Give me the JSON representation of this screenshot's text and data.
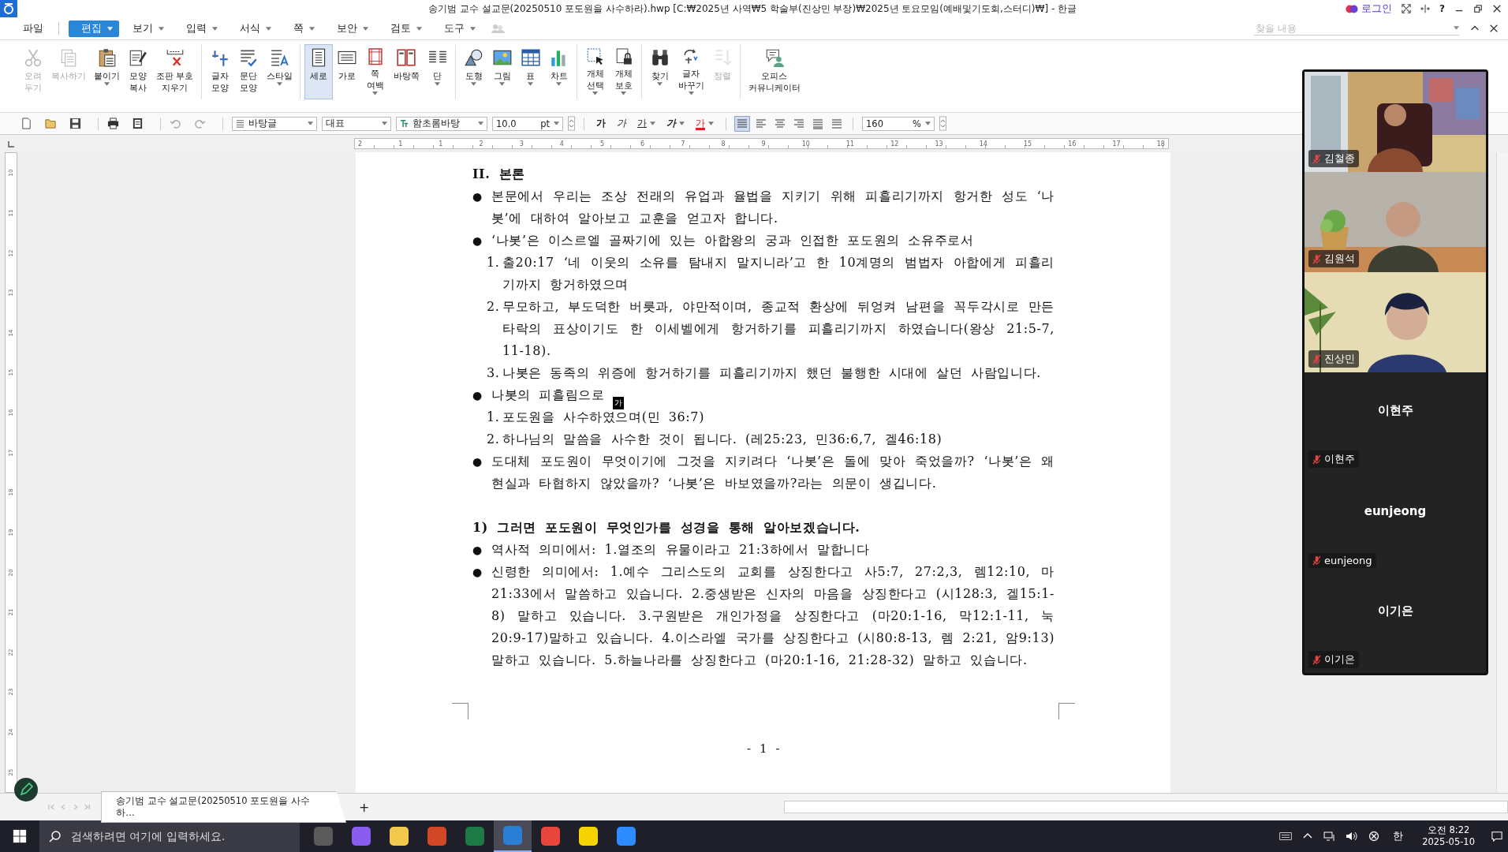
{
  "title_bar": {
    "title": "송기범 교수 설교문(20250510 포도원을 사수하라).hwp [C:₩2025년 사역₩5 학술부(진상민 부장)₩2025년 토요모임(예배및기도회,스터디)₩] - 한글",
    "login": "로그인",
    "help": "?"
  },
  "menu": [
    {
      "label": "파일",
      "dropdown": false,
      "selected": false
    },
    {
      "label": "편집",
      "dropdown": true,
      "selected": true
    },
    {
      "label": "보기",
      "dropdown": true,
      "selected": false
    },
    {
      "label": "입력",
      "dropdown": true,
      "selected": false
    },
    {
      "label": "서식",
      "dropdown": true,
      "selected": false
    },
    {
      "label": "쪽",
      "dropdown": true,
      "selected": false
    },
    {
      "label": "보안",
      "dropdown": true,
      "selected": false
    },
    {
      "label": "검토",
      "dropdown": true,
      "selected": false
    },
    {
      "label": "도구",
      "dropdown": true,
      "selected": false
    }
  ],
  "search": {
    "placeholder": "찾을 내용"
  },
  "ribbon": [
    {
      "lines": [
        "오려",
        "두기"
      ],
      "disabled": true,
      "selected": false,
      "dropdown": false,
      "separator_after": false
    },
    {
      "lines": [
        "복사하기"
      ],
      "disabled": true,
      "selected": false,
      "dropdown": false,
      "separator_after": false
    },
    {
      "lines": [
        "붙이기"
      ],
      "disabled": false,
      "selected": false,
      "dropdown": true,
      "separator_after": false
    },
    {
      "lines": [
        "모양",
        "복사"
      ],
      "disabled": false,
      "selected": false,
      "dropdown": false,
      "separator_after": false
    },
    {
      "lines": [
        "조판 부호",
        "지우기"
      ],
      "disabled": false,
      "selected": false,
      "dropdown": false,
      "separator_after": true
    },
    {
      "lines": [
        "글자",
        "모양"
      ],
      "disabled": false,
      "selected": false,
      "dropdown": false,
      "separator_after": false
    },
    {
      "lines": [
        "문단",
        "모양"
      ],
      "disabled": false,
      "selected": false,
      "dropdown": false,
      "separator_after": false
    },
    {
      "lines": [
        "스타일"
      ],
      "disabled": false,
      "selected": false,
      "dropdown": true,
      "separator_after": true
    },
    {
      "lines": [
        "세로"
      ],
      "disabled": false,
      "selected": true,
      "dropdown": false,
      "separator_after": false
    },
    {
      "lines": [
        "가로"
      ],
      "disabled": false,
      "selected": false,
      "dropdown": false,
      "separator_after": false
    },
    {
      "lines": [
        "쪽",
        "여백"
      ],
      "disabled": false,
      "selected": false,
      "dropdown": true,
      "separator_after": false
    },
    {
      "lines": [
        "바탕쪽"
      ],
      "disabled": false,
      "selected": false,
      "dropdown": false,
      "separator_after": false
    },
    {
      "lines": [
        "단"
      ],
      "disabled": false,
      "selected": false,
      "dropdown": true,
      "separator_after": true
    },
    {
      "lines": [
        "도형"
      ],
      "disabled": false,
      "selected": false,
      "dropdown": true,
      "separator_after": false
    },
    {
      "lines": [
        "그림"
      ],
      "disabled": false,
      "selected": false,
      "dropdown": true,
      "separator_after": false
    },
    {
      "lines": [
        "표"
      ],
      "disabled": false,
      "selected": false,
      "dropdown": true,
      "separator_after": false
    },
    {
      "lines": [
        "차트"
      ],
      "disabled": false,
      "selected": false,
      "dropdown": true,
      "separator_after": true
    },
    {
      "lines": [
        "개체",
        "선택"
      ],
      "disabled": false,
      "selected": false,
      "dropdown": true,
      "separator_after": false
    },
    {
      "lines": [
        "개체",
        "보호"
      ],
      "disabled": false,
      "selected": false,
      "dropdown": true,
      "separator_after": true
    },
    {
      "lines": [
        "찾기"
      ],
      "disabled": false,
      "selected": false,
      "dropdown": true,
      "separator_after": false
    },
    {
      "lines": [
        "글자",
        "바꾸기"
      ],
      "disabled": false,
      "selected": false,
      "dropdown": true,
      "separator_after": false
    },
    {
      "lines": [
        "정렬"
      ],
      "disabled": true,
      "selected": false,
      "dropdown": false,
      "separator_after": true
    },
    {
      "lines": [
        "오피스",
        "커뮤니케이터"
      ],
      "disabled": false,
      "selected": false,
      "dropdown": false,
      "separator_after": false
    }
  ],
  "format_bar": {
    "style": "바탕글",
    "language": "대표",
    "font": "함초롬바탕",
    "size": "10.0",
    "unit": "pt",
    "char_buttons": [
      {
        "kind": "bold",
        "label": "가"
      },
      {
        "kind": "italic",
        "label": "가"
      },
      {
        "kind": "underline",
        "label": "가"
      },
      {
        "kind": "strike",
        "label": "가"
      },
      {
        "kind": "color",
        "label": "가"
      }
    ],
    "align": [
      {
        "selected": true
      },
      {
        "selected": false
      },
      {
        "selected": false
      },
      {
        "selected": false
      },
      {
        "selected": false
      },
      {
        "selected": false
      }
    ],
    "zoom": "160",
    "zoom_unit": "%"
  },
  "ruler": {
    "h_marks": [
      "2",
      "1",
      "1",
      "2",
      "3",
      "4",
      "5",
      "6",
      "7",
      "8",
      "9",
      "10",
      "11",
      "12",
      "13",
      "14",
      "15",
      "16",
      "17",
      "18"
    ],
    "v_marks": [
      "10",
      "11",
      "12",
      "13",
      "14",
      "15",
      "16",
      "17",
      "18",
      "19",
      "20",
      "21",
      "22",
      "23",
      "24",
      "25"
    ]
  },
  "document": {
    "blocks": [
      {
        "kind": "heading",
        "text": "II. 본론"
      },
      {
        "kind": "bullet",
        "marker": "●",
        "text": "본문에서 우리는 조상 전래의 유업과 율법을 지키기 위해 피흘리기까지 항거한 성도 ‘나봇’에 대하여 알아보고 교훈을 얻고자 합니다."
      },
      {
        "kind": "bullet",
        "marker": "●",
        "text": "‘나봇’은 이스르엘 골짜기에 있는 아합왕의 궁과 인접한 포도원의 소유주로서",
        "children": [
          {
            "number": "1.",
            "text": "출20:17 ‘네 이웃의 소유를 탐내지 말지니라’고 한 10계명의 범법자 아합에게 피흘리기까지 항거하였으며"
          },
          {
            "number": "2.",
            "text": "무모하고, 부도덕한 버릇과, 야만적이며, 종교적 환상에 뒤엉켜 남편을 꼭두각시로 만든 타락의 표상이기도 한 이세벨에게 항거하기를 피흘리기까지 하였습니다(왕상 21:5-7, 11-18)."
          },
          {
            "number": "3.",
            "text": "나봇은 동족의 위증에 항거하기를 피흘리기까지 했던 불행한 시대에 살던 사람입니다."
          }
        ]
      },
      {
        "kind": "bullet",
        "marker": "●",
        "text": "나봇의 피흘림으로",
        "children": [
          {
            "number": "1.",
            "text": "포도원을 사수하였으며(민 36:7)"
          },
          {
            "number": "2.",
            "text": "하나님의 말씀을 사수한 것이 됩니다. (레25:23, 민36:6,7, 겔46:18)"
          }
        ]
      },
      {
        "kind": "bullet",
        "marker": "●",
        "text": "도대체 포도원이 무엇이기에 그것을 지키려다 ‘나봇’은 돌에 맞아 죽었을까? ‘나봇’은 왜 현실과 타협하지 않았을까? ‘나봇’은 바보였을까?라는 의문이 생깁니다."
      },
      {
        "kind": "subheading",
        "text": "1) 그러면 포도원이 무엇인가를 성경을 통해 알아보겠습니다."
      },
      {
        "kind": "bullet",
        "marker": "●",
        "text": "역사적 의미에서: 1.열조의 유물이라고 21:3하에서 말합니다"
      },
      {
        "kind": "bullet",
        "marker": "●",
        "text": "신령한 의미에서: 1.예수 그리스도의 교회를 상징한다고 사5:7, 27:2,3, 렘12:10, 마21:33에서 말씀하고 있습니다. 2.중생받은 신자의 마음을 상징한다고 (시128:3, 겔15:1-8) 말하고 있습니다. 3.구원받은 개인가정을 상징한다고 (마20:1-16, 막12:1-11, 눅20:9-17)말하고 있습니다. 4.이스라엘 국가를 상징한다고 (시80:8-13, 렘 2:21, 암9:13) 말하고 있습니다. 5.하늘나라를 상징한다고 (마20:1-16, 21:28-32) 말하고 있습니다."
      }
    ],
    "ime_badge": "가",
    "page_number": "- 1 -"
  },
  "meeting": {
    "participants": [
      {
        "name": "김철종",
        "video": true,
        "muted": true
      },
      {
        "name": "김원석",
        "video": true,
        "muted": true
      },
      {
        "name": "진상민",
        "video": true,
        "muted": true
      },
      {
        "name": "이현주",
        "display_name": "이현주",
        "video": false,
        "muted": true
      },
      {
        "name": "eunjeong",
        "display_name": "eunjeong",
        "video": false,
        "muted": true
      },
      {
        "name": "이기은",
        "display_name": "이기은",
        "video": false,
        "muted": true
      }
    ]
  },
  "doc_tabs": {
    "tabs": [
      {
        "label": "송기범 교수 설교문(20250510 포도원을 사수하…",
        "selected": true
      }
    ],
    "add": "+"
  },
  "taskbar": {
    "search_placeholder": "검색하려면 여기에 입력하세요.",
    "apps": [
      {
        "color": "#5a5a5a",
        "selected": false
      },
      {
        "color": "#8a5cf0",
        "selected": false
      },
      {
        "color": "#f2c94c",
        "selected": false
      },
      {
        "color": "#d24726",
        "selected": false
      },
      {
        "color": "#1d7a45",
        "selected": false
      },
      {
        "color": "#2a7fd4",
        "selected": true
      },
      {
        "color": "#e8453c",
        "selected": false
      },
      {
        "color": "#f7d400",
        "selected": false
      },
      {
        "color": "#2d8cff",
        "selected": false
      }
    ],
    "ime": "한",
    "time": "오전 8:22",
    "date": "2025-05-10"
  }
}
